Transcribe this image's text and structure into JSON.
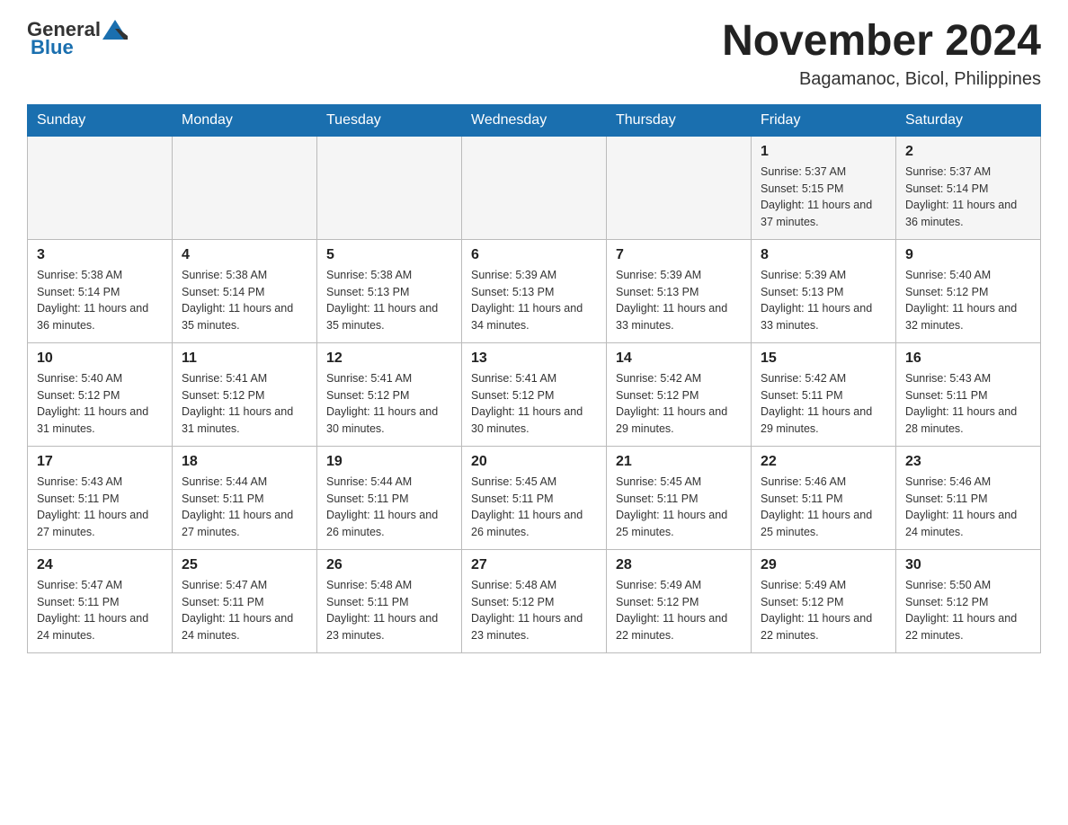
{
  "header": {
    "logo_general": "General",
    "logo_blue": "Blue",
    "title": "November 2024",
    "subtitle": "Bagamanoc, Bicol, Philippines"
  },
  "days_of_week": [
    "Sunday",
    "Monday",
    "Tuesday",
    "Wednesday",
    "Thursday",
    "Friday",
    "Saturday"
  ],
  "weeks": [
    [
      {
        "day": "",
        "info": ""
      },
      {
        "day": "",
        "info": ""
      },
      {
        "day": "",
        "info": ""
      },
      {
        "day": "",
        "info": ""
      },
      {
        "day": "",
        "info": ""
      },
      {
        "day": "1",
        "info": "Sunrise: 5:37 AM\nSunset: 5:15 PM\nDaylight: 11 hours and 37 minutes."
      },
      {
        "day": "2",
        "info": "Sunrise: 5:37 AM\nSunset: 5:14 PM\nDaylight: 11 hours and 36 minutes."
      }
    ],
    [
      {
        "day": "3",
        "info": "Sunrise: 5:38 AM\nSunset: 5:14 PM\nDaylight: 11 hours and 36 minutes."
      },
      {
        "day": "4",
        "info": "Sunrise: 5:38 AM\nSunset: 5:14 PM\nDaylight: 11 hours and 35 minutes."
      },
      {
        "day": "5",
        "info": "Sunrise: 5:38 AM\nSunset: 5:13 PM\nDaylight: 11 hours and 35 minutes."
      },
      {
        "day": "6",
        "info": "Sunrise: 5:39 AM\nSunset: 5:13 PM\nDaylight: 11 hours and 34 minutes."
      },
      {
        "day": "7",
        "info": "Sunrise: 5:39 AM\nSunset: 5:13 PM\nDaylight: 11 hours and 33 minutes."
      },
      {
        "day": "8",
        "info": "Sunrise: 5:39 AM\nSunset: 5:13 PM\nDaylight: 11 hours and 33 minutes."
      },
      {
        "day": "9",
        "info": "Sunrise: 5:40 AM\nSunset: 5:12 PM\nDaylight: 11 hours and 32 minutes."
      }
    ],
    [
      {
        "day": "10",
        "info": "Sunrise: 5:40 AM\nSunset: 5:12 PM\nDaylight: 11 hours and 31 minutes."
      },
      {
        "day": "11",
        "info": "Sunrise: 5:41 AM\nSunset: 5:12 PM\nDaylight: 11 hours and 31 minutes."
      },
      {
        "day": "12",
        "info": "Sunrise: 5:41 AM\nSunset: 5:12 PM\nDaylight: 11 hours and 30 minutes."
      },
      {
        "day": "13",
        "info": "Sunrise: 5:41 AM\nSunset: 5:12 PM\nDaylight: 11 hours and 30 minutes."
      },
      {
        "day": "14",
        "info": "Sunrise: 5:42 AM\nSunset: 5:12 PM\nDaylight: 11 hours and 29 minutes."
      },
      {
        "day": "15",
        "info": "Sunrise: 5:42 AM\nSunset: 5:11 PM\nDaylight: 11 hours and 29 minutes."
      },
      {
        "day": "16",
        "info": "Sunrise: 5:43 AM\nSunset: 5:11 PM\nDaylight: 11 hours and 28 minutes."
      }
    ],
    [
      {
        "day": "17",
        "info": "Sunrise: 5:43 AM\nSunset: 5:11 PM\nDaylight: 11 hours and 27 minutes."
      },
      {
        "day": "18",
        "info": "Sunrise: 5:44 AM\nSunset: 5:11 PM\nDaylight: 11 hours and 27 minutes."
      },
      {
        "day": "19",
        "info": "Sunrise: 5:44 AM\nSunset: 5:11 PM\nDaylight: 11 hours and 26 minutes."
      },
      {
        "day": "20",
        "info": "Sunrise: 5:45 AM\nSunset: 5:11 PM\nDaylight: 11 hours and 26 minutes."
      },
      {
        "day": "21",
        "info": "Sunrise: 5:45 AM\nSunset: 5:11 PM\nDaylight: 11 hours and 25 minutes."
      },
      {
        "day": "22",
        "info": "Sunrise: 5:46 AM\nSunset: 5:11 PM\nDaylight: 11 hours and 25 minutes."
      },
      {
        "day": "23",
        "info": "Sunrise: 5:46 AM\nSunset: 5:11 PM\nDaylight: 11 hours and 24 minutes."
      }
    ],
    [
      {
        "day": "24",
        "info": "Sunrise: 5:47 AM\nSunset: 5:11 PM\nDaylight: 11 hours and 24 minutes."
      },
      {
        "day": "25",
        "info": "Sunrise: 5:47 AM\nSunset: 5:11 PM\nDaylight: 11 hours and 24 minutes."
      },
      {
        "day": "26",
        "info": "Sunrise: 5:48 AM\nSunset: 5:11 PM\nDaylight: 11 hours and 23 minutes."
      },
      {
        "day": "27",
        "info": "Sunrise: 5:48 AM\nSunset: 5:12 PM\nDaylight: 11 hours and 23 minutes."
      },
      {
        "day": "28",
        "info": "Sunrise: 5:49 AM\nSunset: 5:12 PM\nDaylight: 11 hours and 22 minutes."
      },
      {
        "day": "29",
        "info": "Sunrise: 5:49 AM\nSunset: 5:12 PM\nDaylight: 11 hours and 22 minutes."
      },
      {
        "day": "30",
        "info": "Sunrise: 5:50 AM\nSunset: 5:12 PM\nDaylight: 11 hours and 22 minutes."
      }
    ]
  ]
}
